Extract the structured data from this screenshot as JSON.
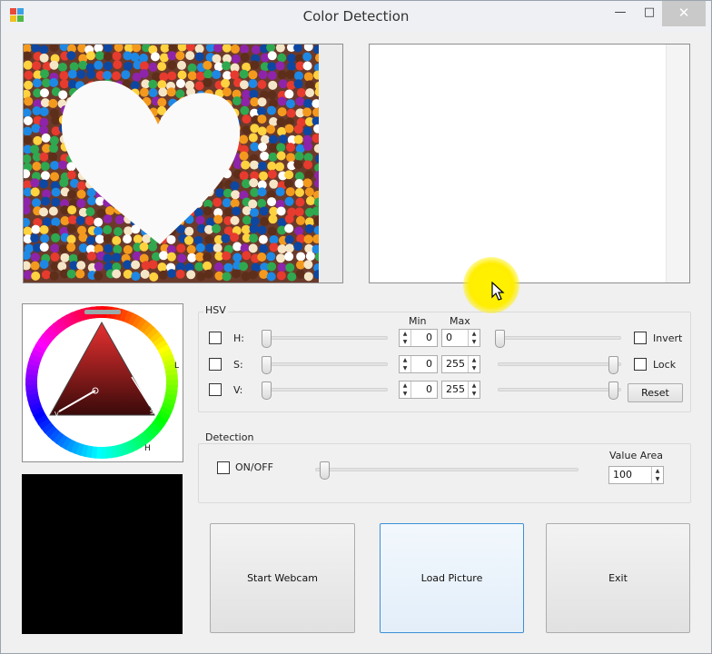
{
  "window": {
    "title": "Color Detection",
    "minimize_glyph": "—",
    "maximize_glyph": "□",
    "close_glyph": "✕"
  },
  "hsv": {
    "group_label": "HSV",
    "min_header": "Min",
    "max_header": "Max",
    "rows": [
      {
        "label": "H:",
        "min": "0",
        "max": "0"
      },
      {
        "label": "S:",
        "min": "0",
        "max": "255"
      },
      {
        "label": "V:",
        "min": "0",
        "max": "255"
      }
    ],
    "invert_label": "Invert",
    "lock_label": "Lock",
    "reset_label": "Reset"
  },
  "color_wheel": {
    "hue_marker": "H",
    "l_marker": "L",
    "s_marker": "S",
    "v_marker": "V"
  },
  "detection": {
    "group_label": "Detection",
    "onoff_label": "ON/OFF",
    "value_area_label": "Value Area",
    "value_area": "100"
  },
  "buttons": {
    "start_webcam": "Start Webcam",
    "load_picture": "Load Picture",
    "exit": "Exit"
  },
  "colors": {
    "accent_focus": "#3c8fd6",
    "cursor_highlight": "#fff200"
  }
}
